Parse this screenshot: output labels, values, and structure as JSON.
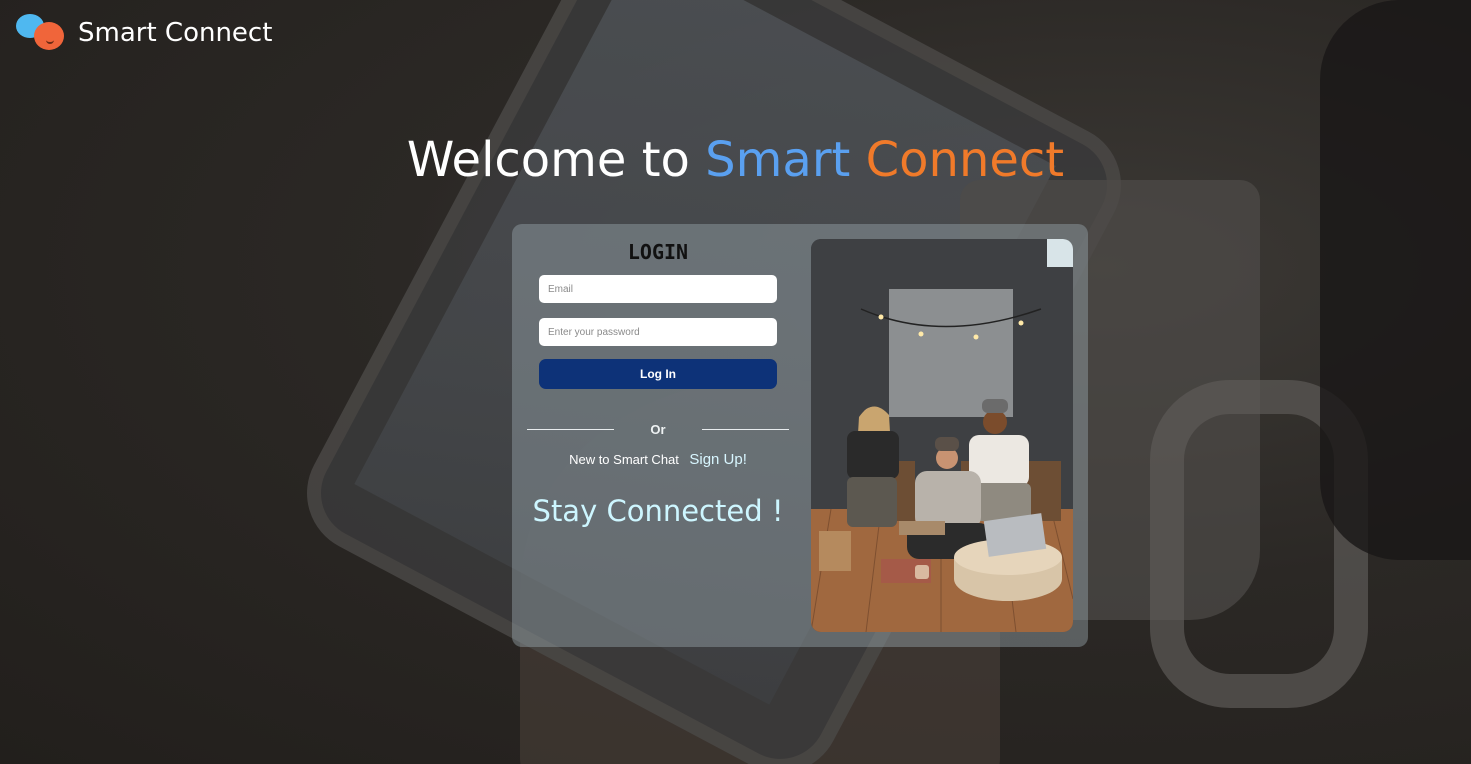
{
  "brand": {
    "name": "Smart Connect"
  },
  "hero": {
    "prefix": "Welcome to",
    "word1": "Smart",
    "word2": "Connect"
  },
  "login": {
    "title": "LOGIN",
    "email_placeholder": "Email",
    "password_placeholder": "Enter your password",
    "button_label": "Log In",
    "divider_text": "Or",
    "signup_prompt": "New to Smart Chat",
    "signup_link": "Sign Up!",
    "tagline": "Stay Connected !"
  },
  "colors": {
    "primary_button": "#0d3278",
    "accent_blue": "#5aa0f0",
    "accent_orange": "#f07a2a",
    "tagline": "#cdf6ff"
  },
  "icons": {
    "logo": "chat-bubbles-logo-icon"
  }
}
